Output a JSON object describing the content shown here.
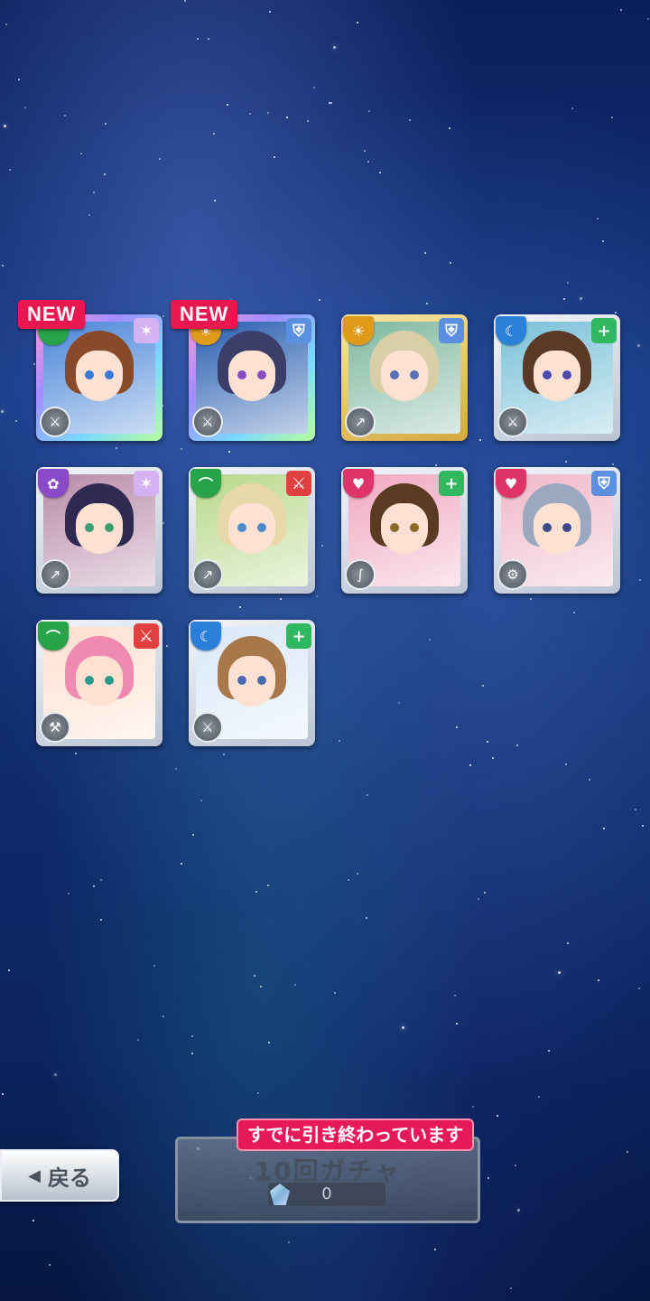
{
  "colors": {
    "new_badge": "#e8174f",
    "banner": "#e6195a"
  },
  "cards": [
    {
      "new": "NEW",
      "frame": "rainbow",
      "attr_color": "#27a34a",
      "attr_icon": "leaf-icon",
      "role_icon": "star-icon",
      "role_color": "#d3b1f2",
      "weapon_icon": "sword-icon",
      "hair": "#8a4a2a",
      "bg": "#4a86d8",
      "eye": "#3b7bd8"
    },
    {
      "new": "NEW",
      "frame": "rainbow",
      "attr_color": "#e09a1a",
      "attr_icon": "sun-icon",
      "role_icon": "shield-icon",
      "role_color": "#5b8fe0",
      "weapon_icon": "sword-icon",
      "hair": "#3a3e68",
      "bg": "#2a5fb0",
      "eye": "#8a4cc0"
    },
    {
      "new": "",
      "frame": "gold",
      "attr_color": "#e09a1a",
      "attr_icon": "sun-icon",
      "role_icon": "shield-icon",
      "role_color": "#5b8fe0",
      "weapon_icon": "gun-icon",
      "hair": "#d8cfa8",
      "bg": "#7fb8a0",
      "eye": "#5c6fb3"
    },
    {
      "new": "",
      "frame": "silver",
      "attr_color": "#2a80d8",
      "attr_icon": "moon-icon",
      "role_icon": "heal-icon",
      "role_color": "#2fb860",
      "weapon_icon": "sword-icon",
      "hair": "#5a3a26",
      "bg": "#78c0d8",
      "eye": "#4a4ab0"
    },
    {
      "new": "",
      "frame": "silver",
      "attr_color": "#8a4ac8",
      "attr_icon": "flower-icon",
      "role_icon": "star-icon",
      "role_color": "#d3b1f2",
      "weapon_icon": "gun-icon",
      "hair": "#2e2a52",
      "bg": "#b88aa8",
      "eye": "#3aa070"
    },
    {
      "new": "",
      "frame": "silver",
      "attr_color": "#27a34a",
      "attr_icon": "leaf-icon",
      "role_icon": "sword-icon",
      "role_color": "#e04040",
      "weapon_icon": "gun-icon",
      "hair": "#e6d8a8",
      "bg": "#b8d88a",
      "eye": "#4a8ac8"
    },
    {
      "new": "",
      "frame": "silver",
      "attr_color": "#e0336a",
      "attr_icon": "heart-icon",
      "role_icon": "heal-icon",
      "role_color": "#2fb860",
      "weapon_icon": "whip-icon",
      "hair": "#5a3a22",
      "bg": "#f0a8c0",
      "eye": "#8a6a2a"
    },
    {
      "new": "",
      "frame": "silver",
      "attr_color": "#e0336a",
      "attr_icon": "heart-icon",
      "role_icon": "shield-icon",
      "role_color": "#5b8fe0",
      "weapon_icon": "gear-icon",
      "hair": "#9aa8c0",
      "bg": "#f0b8c8",
      "eye": "#3a4a8a"
    },
    {
      "new": "",
      "frame": "silver",
      "attr_color": "#27a34a",
      "attr_icon": "leaf-icon",
      "role_icon": "sword-icon",
      "role_color": "#e04040",
      "weapon_icon": "hammer-icon",
      "hair": "#f08ab0",
      "bg": "#ffe0d0",
      "eye": "#2a9a8a"
    },
    {
      "new": "",
      "frame": "silver",
      "attr_color": "#2a80d8",
      "attr_icon": "moon-icon",
      "role_icon": "heal-icon",
      "role_color": "#2fb860",
      "weapon_icon": "sword-icon",
      "hair": "#a8784a",
      "bg": "#d8e8f8",
      "eye": "#4a6ab0"
    }
  ],
  "back_button": {
    "label": "戻る"
  },
  "gacha": {
    "label": "10回ガチャ",
    "cost": "0",
    "status_banner": "すでに引き終わっています"
  }
}
